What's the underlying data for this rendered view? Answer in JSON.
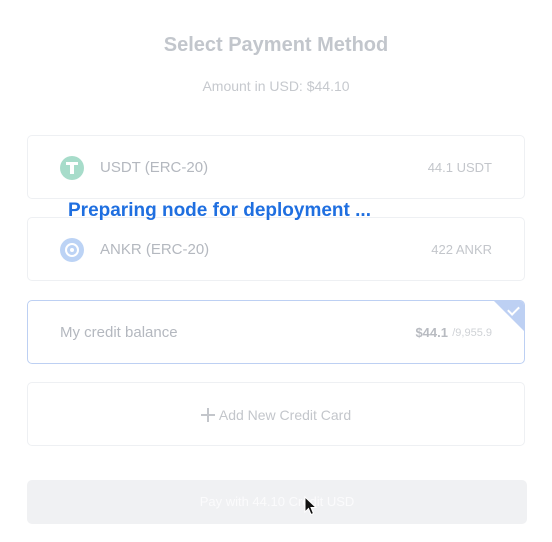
{
  "header": {
    "title": "Select Payment Method",
    "amount_text": "Amount in USD: $44.10"
  },
  "payment_options": [
    {
      "label": "USDT (ERC-20)",
      "amount": "44.1 USDT",
      "icon": "usdt-icon",
      "selected": false
    },
    {
      "label": "ANKR (ERC-20)",
      "amount": "422 ANKR",
      "icon": "ankr-icon",
      "selected": false
    },
    {
      "label": "My credit balance",
      "amount": "$44.1",
      "amount_of": "/9,955.9",
      "selected": true
    }
  ],
  "add_card": {
    "label": "Add New Credit Card",
    "icon": "plus-icon"
  },
  "overlay_status": "Preparing node for deployment ...",
  "pay_button": {
    "label": "Pay with 44.10 Credit USD"
  },
  "colors": {
    "accent": "#1f6fe0",
    "selected_border": "#bdd0f3",
    "usdt": "#a7dcca",
    "ankr": "#bcd3f5"
  }
}
